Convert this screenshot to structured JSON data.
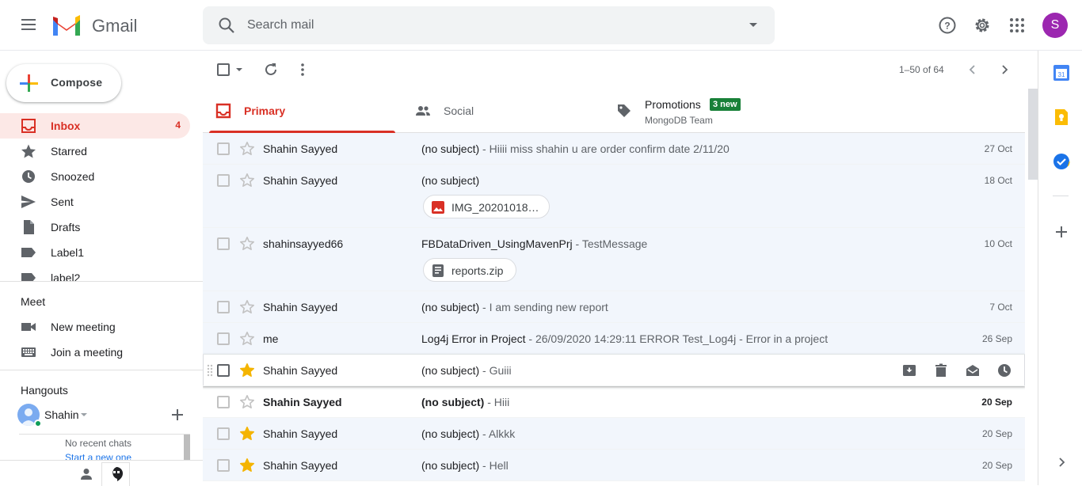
{
  "header": {
    "app_name": "Gmail",
    "search_placeholder": "Search mail",
    "avatar_letter": "S",
    "colors": {
      "avatar": "#9c27b0",
      "brand_red": "#d93025"
    }
  },
  "sidebar": {
    "compose_label": "Compose",
    "items": [
      {
        "label": "Inbox",
        "count": "4",
        "icon": "inbox-icon",
        "active": true
      },
      {
        "label": "Starred",
        "icon": "star-icon"
      },
      {
        "label": "Snoozed",
        "icon": "clock-icon"
      },
      {
        "label": "Sent",
        "icon": "send-icon"
      },
      {
        "label": "Drafts",
        "icon": "draft-icon"
      },
      {
        "label": "Label1",
        "icon": "label-icon"
      },
      {
        "label": "label2",
        "icon": "label-icon"
      }
    ],
    "meet": {
      "title": "Meet",
      "new_meeting": "New meeting",
      "join_meeting": "Join a meeting"
    },
    "hangouts": {
      "title": "Hangouts",
      "user_name": "Shahin",
      "no_recent": "No recent chats",
      "start_new": "Start a new one"
    }
  },
  "toolbar": {
    "page_info": "1–50 of 64"
  },
  "tabs": [
    {
      "label": "Primary",
      "icon": "inbox-icon",
      "active": true
    },
    {
      "label": "Social",
      "icon": "people-icon"
    },
    {
      "label": "Promotions",
      "icon": "tag-icon",
      "badge": "3 new",
      "sub": "MongoDB Team"
    }
  ],
  "emails": [
    {
      "sender": "Shahin Sayyed",
      "subject": "(no subject)",
      "snippet": " - Hiiii miss shahin u are order confirm date 2/11/20",
      "date": "27 Oct",
      "starred": false,
      "unread": false
    },
    {
      "sender": "Shahin Sayyed",
      "subject": "(no subject)",
      "snippet": "",
      "date": "18 Oct",
      "starred": false,
      "unread": false,
      "attachment": "IMG_20201018…",
      "attachment_icon": "image-icon"
    },
    {
      "sender": "shahinsayyed66",
      "subject": "FBDataDriven_UsingMavenPrj",
      "snippet": " - TestMessage",
      "date": "10 Oct",
      "starred": false,
      "unread": false,
      "attachment": "reports.zip",
      "attachment_icon": "zip-icon"
    },
    {
      "sender": "Shahin Sayyed",
      "subject": "(no subject)",
      "snippet": " - I am sending new report",
      "date": "7 Oct",
      "starred": false,
      "unread": false
    },
    {
      "sender": "me",
      "subject": "Log4j Error in Project",
      "snippet": " - 26/09/2020 14:29:11 ERROR Test_Log4j - Error in a project",
      "date": "26 Sep",
      "starred": false,
      "unread": false
    },
    {
      "sender": "Shahin Sayyed",
      "subject": "(no subject)",
      "snippet": " - Guiii",
      "date": "",
      "starred": true,
      "unread": false,
      "hover": true
    },
    {
      "sender": "Shahin Sayyed",
      "subject": "(no subject)",
      "snippet": " - Hiii",
      "date": "20 Sep",
      "starred": false,
      "unread": true
    },
    {
      "sender": "Shahin Sayyed",
      "subject": "(no subject)",
      "snippet": " - Alkkk",
      "date": "20 Sep",
      "starred": true,
      "unread": false
    },
    {
      "sender": "Shahin Sayyed",
      "subject": "(no subject)",
      "snippet": " - Hell",
      "date": "20 Sep",
      "starred": true,
      "unread": false
    }
  ]
}
